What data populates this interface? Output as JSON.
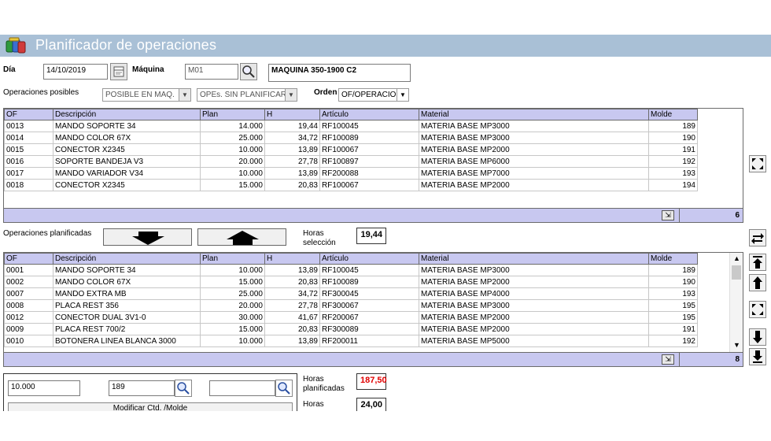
{
  "window": {
    "title": "Planificador de operaciones"
  },
  "header": {
    "dia_label": "Día",
    "dia_value": "14/10/2019",
    "maquina_label": "Máquina",
    "maquina_code": "M01",
    "maquina_desc": "MAQUINA 350-1900 C2",
    "op_posibles_label": "Operaciones posibles",
    "filter1": "POSIBLE EN MAQ.",
    "filter2": "OPEs. SIN PLANIFICAR",
    "orden_label": "Orden",
    "orden_value": "OF/OPERACION"
  },
  "columns": [
    "OF",
    "Descripción",
    "Plan",
    "H",
    "Artículo",
    "Material",
    "Molde"
  ],
  "possible_ops": {
    "rows": [
      [
        "0013",
        "MANDO SOPORTE 34",
        "14.000",
        "19,44",
        "RF100045",
        "MATERIA BASE MP3000",
        "189"
      ],
      [
        "0014",
        "MANDO COLOR 67X",
        "25.000",
        "34,72",
        "RF100089",
        "MATERIA BASE MP3000",
        "190"
      ],
      [
        "0015",
        "CONECTOR X2345",
        "10.000",
        "13,89",
        "RF100067",
        "MATERIA BASE MP2000",
        "191"
      ],
      [
        "0016",
        "SOPORTE BANDEJA V3",
        "20.000",
        "27,78",
        "RF100897",
        "MATERIA BASE MP6000",
        "192"
      ],
      [
        "0017",
        "MANDO VARIADOR V34",
        "10.000",
        "13,89",
        "RF200088",
        "MATERIA BASE MP7000",
        "193"
      ],
      [
        "0018",
        "CONECTOR X2345",
        "15.000",
        "20,83",
        "RF100067",
        "MATERIA BASE MP2000",
        "194"
      ]
    ],
    "count": "6"
  },
  "middle": {
    "planned_label": "Operaciones planificadas",
    "horas_sel_label1": "Horas",
    "horas_sel_label2": "selección",
    "horas_sel_value": "19,44"
  },
  "planned_ops": {
    "rows": [
      [
        "0001",
        "MANDO SOPORTE 34",
        "10.000",
        "13,89",
        "RF100045",
        "MATERIA BASE MP3000",
        "189"
      ],
      [
        "0002",
        "MANDO COLOR 67X",
        "15.000",
        "20,83",
        "RF100089",
        "MATERIA BASE MP2000",
        "190"
      ],
      [
        "0007",
        "MANDO EXTRA MB",
        "25.000",
        "34,72",
        "RF300045",
        "MATERIA BASE MP4000",
        "193"
      ],
      [
        "0008",
        "PLACA REST 356",
        "20.000",
        "27,78",
        "RF300067",
        "MATERIA BASE MP3000",
        "195"
      ],
      [
        "0012",
        "CONECTOR DUAL 3V1-0",
        "30.000",
        "41,67",
        "RF200067",
        "MATERIA BASE MP2000",
        "195"
      ],
      [
        "0009",
        "PLACA REST 700/2",
        "15.000",
        "20,83",
        "RF300089",
        "MATERIA BASE MP2000",
        "191"
      ],
      [
        "0010",
        "BOTONERA LINEA BLANCA 3000",
        "10.000",
        "13,89",
        "RF200011",
        "MATERIA BASE MP5000",
        "192"
      ]
    ],
    "count": "8"
  },
  "bottom": {
    "qty_value": "10.000",
    "molde_value": "189",
    "modify_label": "Modificar Ctd. /Molde",
    "horas_plan_label1": "Horas",
    "horas_plan_label2": "planificadas",
    "horas_plan_value": "187,50",
    "horas2_label": "Horas",
    "horas2_value": "24,00"
  },
  "colors": {
    "titlebar": "#a9c0d6",
    "header": "#c8c8f0",
    "accent_red": "#e00000"
  }
}
